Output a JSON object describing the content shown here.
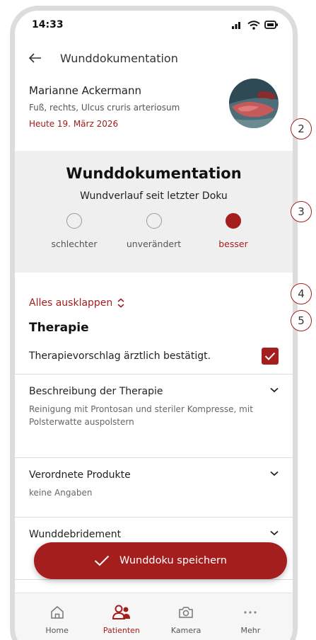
{
  "colors": {
    "accent": "#a51e1e",
    "panel": "#efefef",
    "text": "#222222"
  },
  "status_bar": {
    "time": "14:33",
    "icons": [
      "signal-icon",
      "wifi-icon",
      "battery-icon"
    ]
  },
  "app_bar": {
    "title": "Wunddokumentation",
    "back_icon": "arrow-left-icon"
  },
  "patient": {
    "name": "Marianne Ackermann",
    "diagnosis": "Fuß, rechts, Ulcus cruris arteriosum",
    "date": "Heute 19. März 2026"
  },
  "assessment": {
    "heading": "Wunddokumentation",
    "subheading": "Wundverlauf seit letzter Doku",
    "options": [
      {
        "label": "schlechter",
        "selected": false
      },
      {
        "label": "unverändert",
        "selected": false
      },
      {
        "label": "besser",
        "selected": true
      }
    ]
  },
  "expand_all": {
    "label": "Alles ausklappen"
  },
  "therapy": {
    "title": "Therapie",
    "confirm_label": "Therapievorschlag ärztlich bestätigt.",
    "confirmed": true
  },
  "accordion": [
    {
      "title": "Beschreibung der Therapie",
      "description": "Reinigung mit Prontosan und steriler Kompresse, mit Polsterwatte auspolstern"
    },
    {
      "title": "Verordnete Produkte",
      "description": "keine Angaben"
    },
    {
      "title": "Wunddebridement",
      "description": ""
    }
  ],
  "save_button": {
    "label": "Wunddoku speichern"
  },
  "bottom_nav": [
    {
      "label": "Home",
      "icon": "home-icon",
      "active": false
    },
    {
      "label": "Patienten",
      "icon": "patients-icon",
      "active": true
    },
    {
      "label": "Kamera",
      "icon": "camera-icon",
      "active": false
    },
    {
      "label": "Mehr",
      "icon": "more-icon",
      "active": false
    }
  ],
  "callouts": [
    "2",
    "3",
    "4",
    "5"
  ]
}
